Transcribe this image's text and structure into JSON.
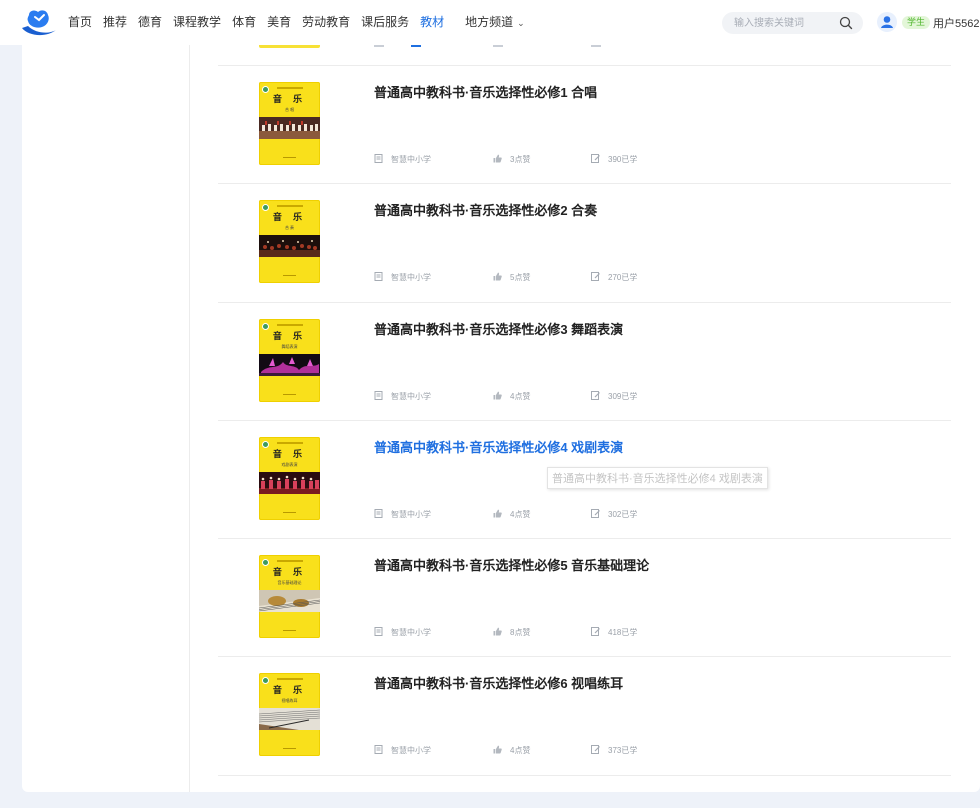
{
  "nav": {
    "items": [
      "首页",
      "推荐",
      "德育",
      "课程教学",
      "体育",
      "美育",
      "劳动教育",
      "课后服务",
      "教材"
    ],
    "active": "教材",
    "local_channel": "地方频道"
  },
  "search": {
    "placeholder": "输入搜索关键词"
  },
  "user": {
    "role": "学生",
    "name": "用户5562"
  },
  "books": [
    {
      "title": "普通高中教科书·音乐选择性必修1 合唱",
      "cover_title": "音 乐",
      "cover_sub": "合 唱",
      "publisher": "智慧中小学",
      "likes": "3点赞",
      "learned": "390已学"
    },
    {
      "title": "普通高中教科书·音乐选择性必修2 合奏",
      "cover_title": "音 乐",
      "cover_sub": "合 奏",
      "publisher": "智慧中小学",
      "likes": "5点赞",
      "learned": "270已学"
    },
    {
      "title": "普通高中教科书·音乐选择性必修3 舞蹈表演",
      "cover_title": "音 乐",
      "cover_sub": "舞蹈表演",
      "publisher": "智慧中小学",
      "likes": "4点赞",
      "learned": "309已学"
    },
    {
      "title": "普通高中教科书·音乐选择性必修4 戏剧表演",
      "cover_title": "音 乐",
      "cover_sub": "戏剧表演",
      "publisher": "智慧中小学",
      "likes": "4点赞",
      "learned": "302已学"
    },
    {
      "title": "普通高中教科书·音乐选择性必修5 音乐基础理论",
      "cover_title": "音 乐",
      "cover_sub": "音乐基础理论",
      "publisher": "智慧中小学",
      "likes": "8点赞",
      "learned": "418已学"
    },
    {
      "title": "普通高中教科书·音乐选择性必修6 视唱练耳",
      "cover_title": "音 乐",
      "cover_sub": "视唱练耳",
      "publisher": "智慧中小学",
      "likes": "4点赞",
      "learned": "373已学"
    }
  ],
  "hovered_index": 3,
  "tooltip": "普通高中教科书·音乐选择性必修4 戏剧表演",
  "colors": {
    "accent": "#1e6fe0",
    "cover_yellow": "#f9e01b",
    "badge_green": "#4fb52c"
  }
}
